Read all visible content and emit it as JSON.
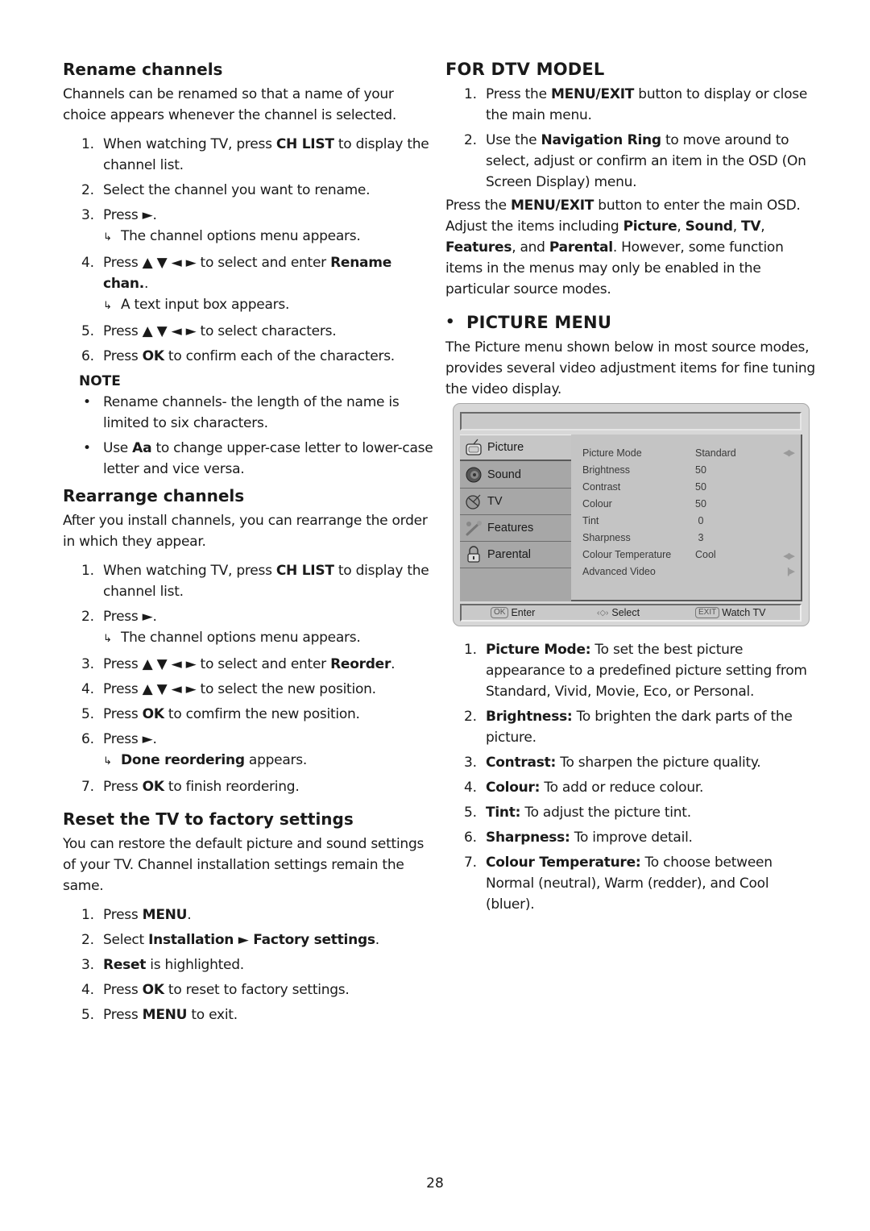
{
  "page_number": "28",
  "left": {
    "rename": {
      "title": "Rename channels",
      "intro": "Channels can be renamed so that a name of your choice appears whenever the channel is selected.",
      "steps": [
        {
          "num": "1.",
          "pre": "When watching TV, press ",
          "bold": "CH LIST",
          "post": " to display the channel list."
        },
        {
          "num": "2.",
          "text": "Select the channel you want to rename."
        },
        {
          "num": "3.",
          "text": "Press ►.",
          "result": "The channel options menu appears."
        },
        {
          "num": "4.",
          "pre": "Press ▲ ▼ ◄ ► to select and enter ",
          "bold": "Rename chan.",
          "post": ".",
          "result": "A text input box appears."
        },
        {
          "num": "5.",
          "text": "Press ▲ ▼ ◄ ► to select characters."
        },
        {
          "num": "6.",
          "pre": "Press ",
          "bold": "OK",
          "post": " to confirm each of the characters."
        }
      ],
      "note_title": "NOTE",
      "notes": [
        {
          "text": "Rename channels- the length of the name is limited to six characters."
        },
        {
          "pre": "Use ",
          "bold": "Aa",
          "post": " to change upper-case letter to lower-case letter and vice versa."
        }
      ]
    },
    "rearrange": {
      "title": "Rearrange channels",
      "intro": "After you install channels, you can rearrange the order in which they appear.",
      "steps": [
        {
          "num": "1.",
          "pre": "When watching TV, press ",
          "bold": "CH LIST",
          "post": " to display the channel list."
        },
        {
          "num": "2.",
          "text": "Press ►.",
          "result": "The channel options menu appears."
        },
        {
          "num": "3.",
          "pre": "Press ▲ ▼ ◄ ► to select and enter ",
          "bold": "Reorder",
          "post": "."
        },
        {
          "num": "4.",
          "text": "Press ▲ ▼ ◄ ► to select the new position."
        },
        {
          "num": "5.",
          "pre": "Press ",
          "bold": "OK",
          "post": " to comfirm the new position."
        },
        {
          "num": "6.",
          "text": "Press ►.",
          "result_bold": "Done reordering",
          "result_post": " appears."
        },
        {
          "num": "7.",
          "pre": "Press ",
          "bold": "OK",
          "post": " to finish reordering."
        }
      ]
    },
    "reset": {
      "title": "Reset the TV to factory settings",
      "intro": "You can restore the default picture and sound settings of your TV. Channel installation settings remain the same.",
      "steps": [
        {
          "num": "1.",
          "pre": "Press ",
          "bold": "MENU",
          "post": "."
        },
        {
          "num": "2.",
          "pre": "Select ",
          "bold": "Installation ► Factory settings",
          "post": "."
        },
        {
          "num": "3.",
          "pre": "",
          "bold": "Reset",
          "post": " is highlighted."
        },
        {
          "num": "4.",
          "pre": "Press ",
          "bold": "OK",
          "post": " to reset to factory settings."
        },
        {
          "num": "5.",
          "pre": "Press ",
          "bold": "MENU",
          "post": " to exit."
        }
      ]
    }
  },
  "right": {
    "dtv": {
      "title": "FOR DTV MODEL",
      "steps": [
        {
          "num": "1.",
          "pre": "Press the ",
          "bold": "MENU/EXIT",
          "post": " button to display or close the main menu."
        },
        {
          "num": "2.",
          "pre": "Use the ",
          "bold": "Navigation Ring",
          "post": " to move around to select, adjust or confirm an item in the OSD (On Screen Display) menu."
        }
      ],
      "para": {
        "a": "Press the ",
        "b1": "MENU/EXIT",
        "c": " button to enter the main OSD. Adjust the items including ",
        "b2": "Picture",
        "d": ", ",
        "b3": "Sound",
        "e": ", ",
        "b4": "TV",
        "f": ", ",
        "b5": "Features",
        "g": ", and ",
        "b6": "Parental",
        "h": ". However, some function items in the menus may only be enabled in the particular source modes."
      }
    },
    "picture": {
      "title": "PICTURE MENU",
      "intro": "The Picture menu shown below in most source modes, provides several video adjustment items for fine tuning the video display.",
      "osd": {
        "side_items": [
          {
            "label": "Picture",
            "icon": "tv-icon",
            "active": true
          },
          {
            "label": "Sound",
            "icon": "speaker-icon"
          },
          {
            "label": "TV",
            "icon": "satellite-dish-icon"
          },
          {
            "label": "Features",
            "icon": "wrench-icon"
          },
          {
            "label": "Parental",
            "icon": "padlock-icon"
          }
        ],
        "rows": [
          {
            "label": "Picture Mode",
            "value": "Standard",
            "control": "◀▶"
          },
          {
            "label": "Brightness",
            "value": "50"
          },
          {
            "label": "Contrast",
            "value": "50"
          },
          {
            "label": "Colour",
            "value": "50"
          },
          {
            "label": "Tint",
            "value": " 0"
          },
          {
            "label": "Sharpness",
            "value": " 3"
          },
          {
            "label": "Colour Temperature",
            "value": "Cool",
            "control": "◀▶"
          },
          {
            "label": "Advanced Video",
            "value": "",
            "control": "||▶"
          }
        ],
        "footer": {
          "ok_key": "OK",
          "ok_label": "Enter",
          "select_label": "Select",
          "exit_key": "EXIT",
          "exit_label": "Watch TV"
        }
      },
      "items": [
        {
          "num": "1.",
          "bold": "Picture Mode:",
          "text": " To set the best picture appearance to a predefined picture setting from Standard, Vivid, Movie, Eco, or Personal."
        },
        {
          "num": "2.",
          "bold": "Brightness:",
          "text": " To brighten the dark parts of the picture."
        },
        {
          "num": "3.",
          "bold": "Contrast:",
          "text": " To sharpen the picture quality."
        },
        {
          "num": "4.",
          "bold": "Colour:",
          "text": " To add or reduce colour."
        },
        {
          "num": "5.",
          "bold": "Tint:",
          "text": " To adjust the picture tint."
        },
        {
          "num": "6.",
          "bold": "Sharpness:",
          "text": " To improve detail."
        },
        {
          "num": "7.",
          "bold": "Colour Temperature:",
          "text": " To choose between Normal (neutral), Warm (redder), and Cool (bluer)."
        }
      ]
    }
  }
}
